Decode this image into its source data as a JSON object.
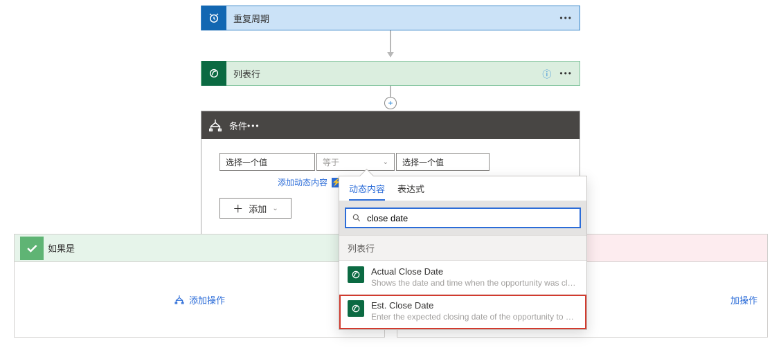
{
  "nodes": {
    "recurrence": {
      "title": "重复周期"
    },
    "list_rows": {
      "title": "列表行"
    }
  },
  "condition": {
    "title": "条件",
    "left_placeholder": "选择一个值",
    "operator": "等于",
    "right_placeholder": "选择一个值",
    "add_dynamic_content": "添加动态内容",
    "add": "添加"
  },
  "branches": {
    "yes": {
      "title": "如果是",
      "add_action": "添加操作"
    },
    "no": {
      "add_action": "加操作"
    }
  },
  "flyout": {
    "tab_dynamic": "动态内容",
    "tab_expression": "表达式",
    "search_value": "close date",
    "section": "列表行",
    "items": [
      {
        "label": "Actual Close Date",
        "desc": "Shows the date and time when the opportunity was closed o..."
      },
      {
        "label": "Est. Close Date",
        "desc": "Enter the expected closing date of the opportunity to help ..."
      }
    ]
  }
}
